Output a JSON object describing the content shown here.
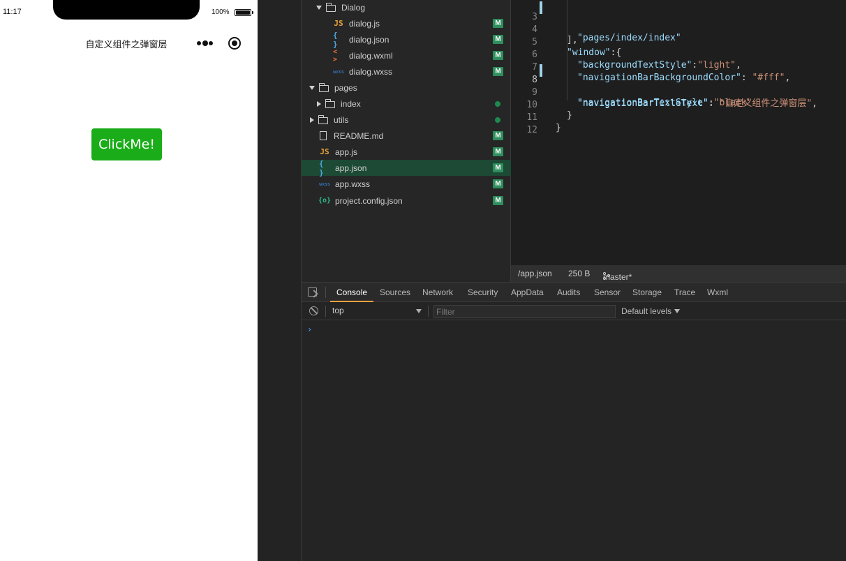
{
  "simulator": {
    "time": "11:17",
    "battery": "100%",
    "nav_title": "自定义组件之弹窗层",
    "button_label": "ClickMe!",
    "button_color": "#1aad19"
  },
  "tree": {
    "items": [
      {
        "label": "Dialog",
        "icon": "folder-open-icon",
        "badge": ""
      },
      {
        "label": "dialog.js",
        "icon": "js-file-icon",
        "badge": "M"
      },
      {
        "label": "dialog.json",
        "icon": "json-file-icon",
        "badge": "M"
      },
      {
        "label": "dialog.wxml",
        "icon": "wxml-file-icon",
        "badge": "M"
      },
      {
        "label": "dialog.wxss",
        "icon": "wxss-file-icon",
        "badge": "M"
      },
      {
        "label": "pages",
        "icon": "folder-open-icon",
        "badge": ""
      },
      {
        "label": "index",
        "icon": "folder-icon",
        "badge": "dot"
      },
      {
        "label": "utils",
        "icon": "folder-icon",
        "badge": "dot"
      },
      {
        "label": "README.md",
        "icon": "file-icon",
        "badge": "M"
      },
      {
        "label": "app.js",
        "icon": "js-file-icon",
        "badge": "M"
      },
      {
        "label": "app.json",
        "icon": "json-file-icon",
        "badge": "M"
      },
      {
        "label": "app.wxss",
        "icon": "wxss-file-icon",
        "badge": "M"
      },
      {
        "label": "project.config.json",
        "icon": "config-file-icon",
        "badge": "M"
      }
    ],
    "icon_glyphs": {
      "js": "JS",
      "json": "{ }",
      "wxml": "< >",
      "wxss": "wxss",
      "cfg": "{o}"
    },
    "selected": "app.json",
    "badge_color": "#2e8e5c"
  },
  "editor": {
    "line_numbers": [
      "3",
      "4",
      "5",
      "6",
      "7",
      "8",
      "9",
      "10",
      "11",
      "12"
    ],
    "l3_key": "\"pages/index/index\"",
    "l4": "],",
    "l5_key": "\"window\"",
    "l5_rest": ":{",
    "l6_key": "\"backgroundTextStyle\"",
    "l6_sep": ":",
    "l6_val": "\"light\"",
    "l6_end": ",",
    "l7_key": "\"navigationBarBackgroundColor\"",
    "l7_sep": ": ",
    "l7_val": "\"#fff\"",
    "l7_end": ",",
    "l8_key": "\"navigationBarTitleText\"",
    "l8_sep": ": ",
    "l8_val": "\"自定义组件之弹窗层\"",
    "l8_end": ",",
    "l9_key": "\"navigationBarTextStyle\"",
    "l9_sep": ":",
    "l9_val": "\"black\"",
    "l10": "}",
    "l11": "}"
  },
  "statusbar": {
    "path": "/app.json",
    "size": "250 B",
    "branch": "master*"
  },
  "devtools": {
    "tabs": [
      "Console",
      "Sources",
      "Network",
      "Security",
      "AppData",
      "Audits",
      "Sensor",
      "Storage",
      "Trace",
      "Wxml"
    ],
    "active_tab": "Console",
    "context": "top",
    "filter_placeholder": "Filter",
    "levels": "Default levels",
    "prompt": "›"
  }
}
